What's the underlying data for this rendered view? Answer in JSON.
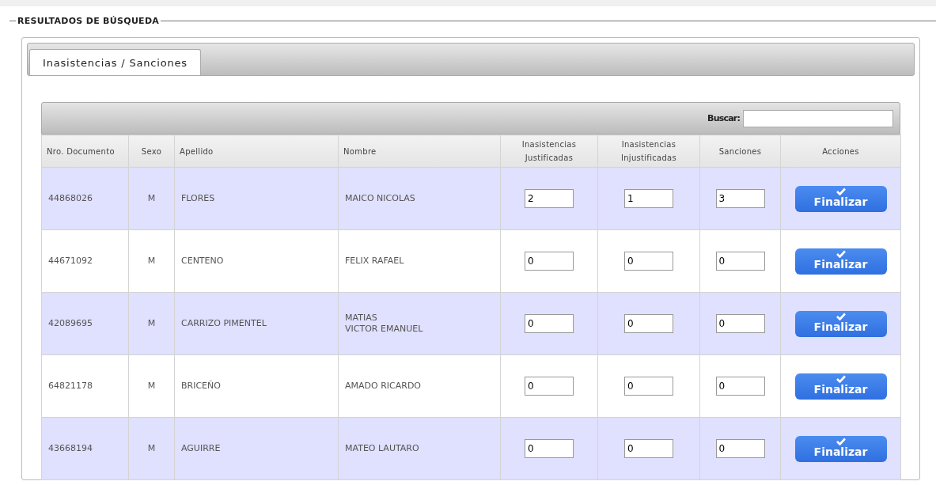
{
  "section_title": "RESULTADOS DE BÚSQUEDA",
  "tabs": [
    {
      "label": "Inasistencias / Sanciones",
      "selected": true
    }
  ],
  "search": {
    "label": "Buscar:"
  },
  "table": {
    "columns": [
      "Nro. Documento",
      "Sexo",
      "Apellido",
      "Nombre",
      "Inasistencias Justificadas",
      "Inasistencias Injustificadas",
      "Sanciones",
      "Acciones"
    ],
    "rows": [
      {
        "documento": "44868026",
        "sexo": "M",
        "apellido": "FLORES",
        "nombre": [
          "MAICO NICOLAS"
        ],
        "justificadas": "2",
        "injustificadas": "1",
        "sanciones": "3",
        "action": "Finalizar"
      },
      {
        "documento": "44671092",
        "sexo": "M",
        "apellido": "CENTENO",
        "nombre": [
          "FELIX RAFAEL"
        ],
        "justificadas": "0",
        "injustificadas": "0",
        "sanciones": "0",
        "action": "Finalizar"
      },
      {
        "documento": "42089695",
        "sexo": "M",
        "apellido": "CARRIZO PIMENTEL",
        "nombre": [
          "MATIAS",
          "VICTOR EMANUEL"
        ],
        "justificadas": "0",
        "injustificadas": "0",
        "sanciones": "0",
        "action": "Finalizar"
      },
      {
        "documento": "64821178",
        "sexo": "M",
        "apellido": "BRICEÑO",
        "nombre": [
          "AMADO RICARDO"
        ],
        "justificadas": "0",
        "injustificadas": "0",
        "sanciones": "0",
        "action": "Finalizar"
      },
      {
        "documento": "43668194",
        "sexo": "M",
        "apellido": "AGUIRRE",
        "nombre": [
          "MATEO LAUTARO"
        ],
        "justificadas": "0",
        "injustificadas": "0",
        "sanciones": "0",
        "action": "Finalizar"
      }
    ]
  }
}
